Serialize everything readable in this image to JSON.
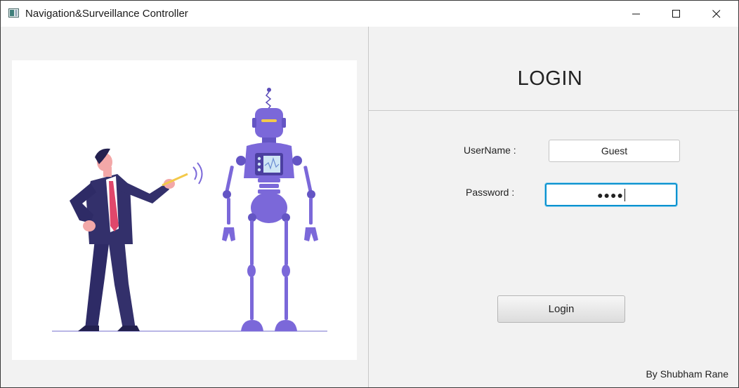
{
  "window": {
    "title": "Navigation&Surveillance Controller",
    "icons": [
      "app-icon",
      "minimize-icon",
      "maximize-icon",
      "close-icon"
    ]
  },
  "login": {
    "heading": "LOGIN",
    "username_label": "UserName :",
    "username_value": "Guest",
    "password_label": "Password :",
    "password_masked": "●●●●",
    "button_label": "Login"
  },
  "footer": {
    "credit": "By Shubham Rane"
  },
  "colors": {
    "focus_border": "#0a92cf",
    "robot": "#7b68d9",
    "suit": "#33306b",
    "tie": "#e0476b"
  }
}
